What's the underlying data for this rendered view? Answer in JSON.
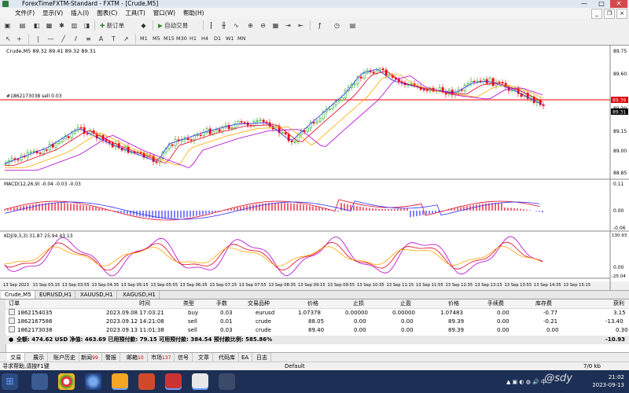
{
  "window": {
    "title": "ForexTimeFXTM-Standard - FXTM - [Crude,M5]",
    "controls": [
      "—",
      "□",
      "✕"
    ]
  },
  "menu": {
    "items": [
      "文件(F)",
      "显示(V)",
      "插入(I)",
      "图表(C)",
      "工具(T)",
      "窗口(W)",
      "帮助(H)"
    ]
  },
  "toolbar": {
    "new_order": "新订单",
    "auto_trading": "自动交易",
    "timeframes": [
      "M1",
      "M5",
      "M15",
      "M30",
      "H1",
      "H4",
      "D1",
      "W1",
      "MN"
    ]
  },
  "chart": {
    "info": "Crude,M5  89.32 89.41 89.32 89.31",
    "order_line_label": "#1862173038 sell 0.03",
    "price_axis": [
      "89.75",
      "89.60",
      "89.45",
      "89.30",
      "89.15",
      "89.00",
      "88.85"
    ],
    "order_line_price": "89.39",
    "current_price": "89.31",
    "macd_label": "MACD(12,26,9) -0.04 -0.03 -0.03",
    "macd_axis": [
      "0.11",
      "0.00",
      "-0.06"
    ],
    "kdj_label": "KDJ(9,3,3) 31.87 25.94 43.13",
    "kdj_axis": [
      "130.93",
      "0.00",
      "-25.04"
    ],
    "time_axis": [
      "13 Sep 2023",
      "13 Sep 03:15",
      "13 Sep 03:55",
      "13 Sep 04:35",
      "13 Sep 05:15",
      "13 Sep 05:55",
      "13 Sep 06:35",
      "13 Sep 07:15",
      "13 Sep 07:55",
      "13 Sep 08:35",
      "13 Sep 09:15",
      "13 Sep 09:55",
      "13 Sep 10:35",
      "13 Sep 11:15",
      "13 Sep 11:55",
      "13 Sep 12:35",
      "13 Sep 13:15",
      "13 Sep 13:55",
      "13 Sep 14:35",
      "13 Sep 15:15"
    ],
    "tabs": [
      "Crude,M5",
      "EURUSD,H1",
      "XAUUSD,H1",
      "XAGUSD,H1"
    ],
    "colors": {
      "bull": "#00a000",
      "bear": "#ff0000",
      "ma_blue": "#3030ff",
      "ma_red": "#e0001e",
      "ma_orange": "#ffaa00",
      "ma_violet": "#b000d0"
    }
  },
  "terminal": {
    "headers": [
      "订单",
      "时间",
      "类型",
      "手数",
      "交易品种",
      "价格",
      "止损",
      "止盈",
      "价格",
      "手续费",
      "库存费",
      "获利"
    ],
    "rows": [
      {
        "order": "1862154035",
        "time": "2023.09.08 17:03:21",
        "type": "buy",
        "lots": "0.03",
        "symbol": "eurusd",
        "price": "1.07378",
        "sl": "0.00000",
        "tp": "0.00000",
        "cur": "1.07483",
        "comm": "0.00",
        "swap": "-0.77",
        "profit": "3.15"
      },
      {
        "order": "1862167586",
        "time": "2023.09.12 14:21:08",
        "type": "sell",
        "lots": "0.01",
        "symbol": "crude",
        "price": "88.05",
        "sl": "0.00",
        "tp": "0.00",
        "cur": "89.39",
        "comm": "0.00",
        "swap": "-0.21",
        "profit": "-13.40"
      },
      {
        "order": "1862173038",
        "time": "2023.09.13 11:01:38",
        "type": "sell",
        "lots": "0.03",
        "symbol": "crude",
        "price": "89.40",
        "sl": "0.00",
        "tp": "0.00",
        "cur": "89.39",
        "comm": "0.00",
        "swap": "0.00",
        "profit": "0.30"
      }
    ],
    "summary": "全额: 474.62 USD  净值: 463.69  已用预付款: 79.15  可用预付款: 384.54  预付款比例: 585.86%",
    "summary_total": "-10.93",
    "tabs": [
      {
        "label": "交易",
        "count": ""
      },
      {
        "label": "展示",
        "count": ""
      },
      {
        "label": "账户历史",
        "count": ""
      },
      {
        "label": "新闻",
        "count": "99"
      },
      {
        "label": "警报",
        "count": ""
      },
      {
        "label": "邮箱",
        "count": "10"
      },
      {
        "label": "市场",
        "count": "137"
      },
      {
        "label": "信号",
        "count": ""
      },
      {
        "label": "文章",
        "count": ""
      },
      {
        "label": "代码库",
        "count": ""
      },
      {
        "label": "EA",
        "count": ""
      },
      {
        "label": "日志",
        "count": ""
      }
    ]
  },
  "status": {
    "help": "寻求帮助,请按F1键",
    "profile": "Default",
    "traffic": "7/0 kb"
  },
  "taskbar": {
    "time": "21:02",
    "date": "2023-09-13",
    "watermark": "@sdy",
    "tray_lang": "中"
  }
}
